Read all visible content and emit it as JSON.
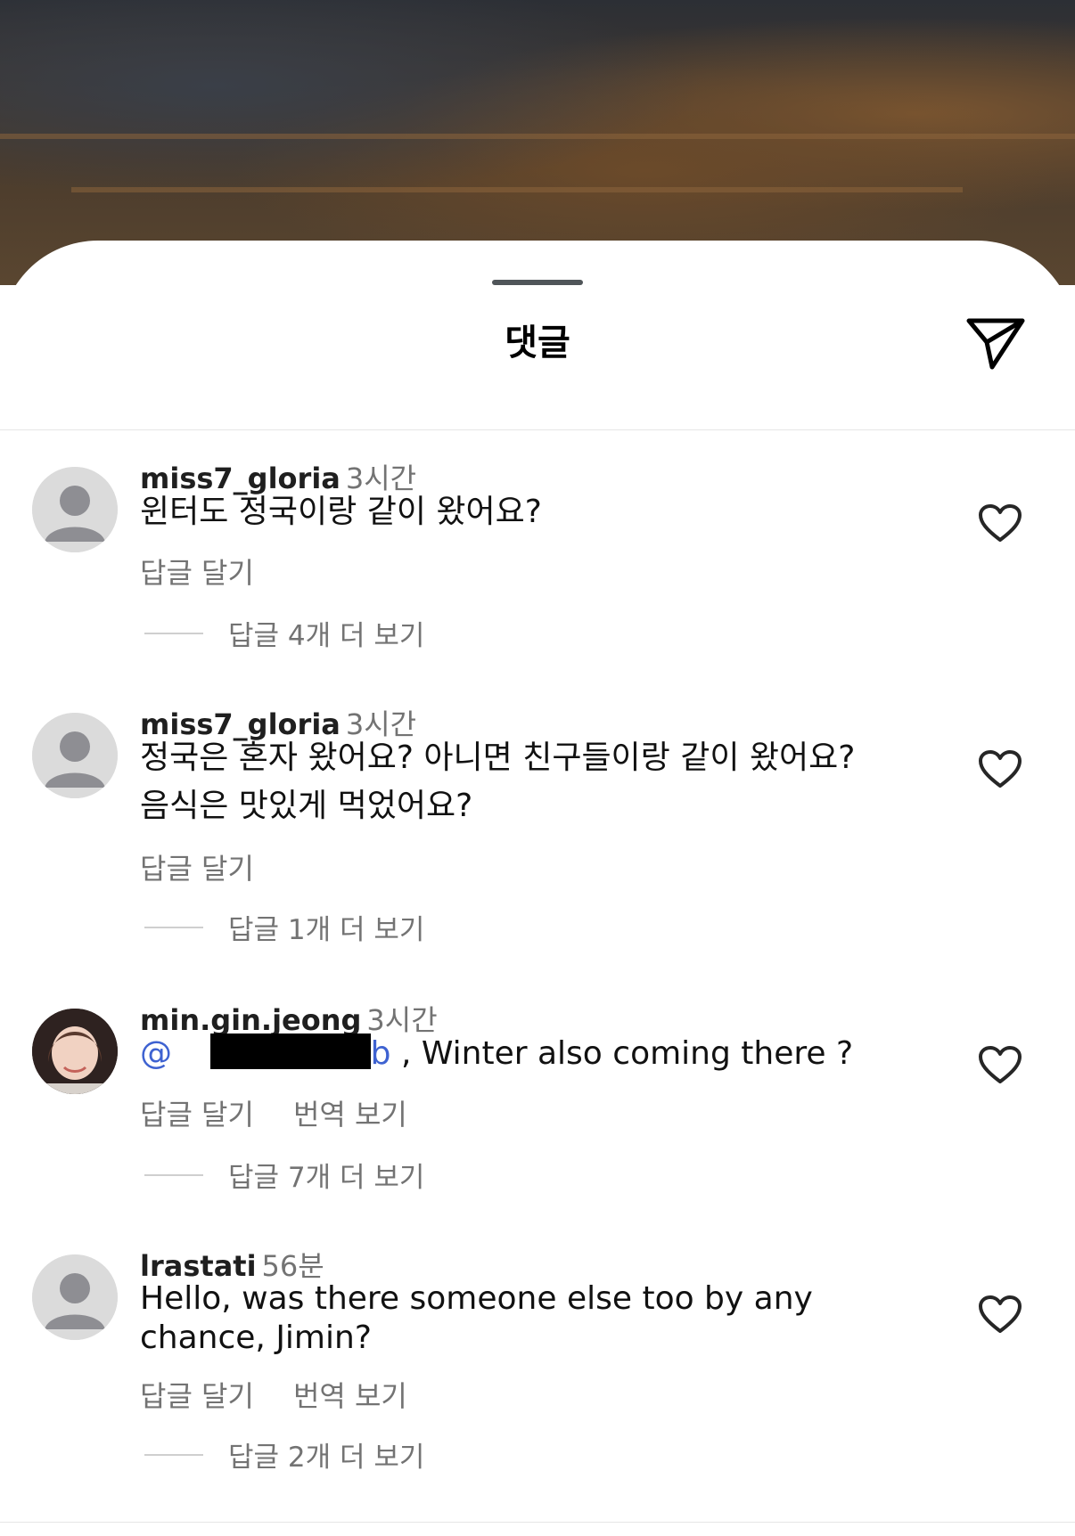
{
  "sheet": {
    "title": "댓글",
    "share_icon": "paper-plane-icon"
  },
  "comments": [
    {
      "username": "miss7_gloria",
      "time": "3시간",
      "text_lines": [
        "윈터도 정국이랑 같이 왔어요?"
      ],
      "reply_label": "답글 달기",
      "view_replies": "답글 4개 더 보기"
    },
    {
      "username": "miss7_gloria",
      "time": "3시간",
      "text_lines": [
        "정국은 혼자 왔어요? 아니면 친구들이랑 같이 왔어요?",
        "음식은 맛있게 먹었어요?"
      ],
      "reply_label": "답글 달기",
      "view_replies": "답글 1개 더 보기"
    },
    {
      "username": "min.gin.jeong",
      "time": "3시간",
      "mention_start": "@",
      "mention_end": "b",
      "text_rest": " , Winter also coming there ?",
      "reply_label": "답글 달기",
      "translate_label": "번역 보기",
      "view_replies": "답글 7개 더 보기"
    },
    {
      "username": "lrastati",
      "time": "56분",
      "text_lines": [
        "Hello, was there someone else too by any",
        "chance, Jimin?"
      ],
      "reply_label": "답글 달기",
      "translate_label": "번역 보기",
      "view_replies": "답글 2개 더 보기"
    }
  ],
  "icons": {
    "like": "heart-outline-icon",
    "avatar_default": "default-avatar-icon"
  }
}
